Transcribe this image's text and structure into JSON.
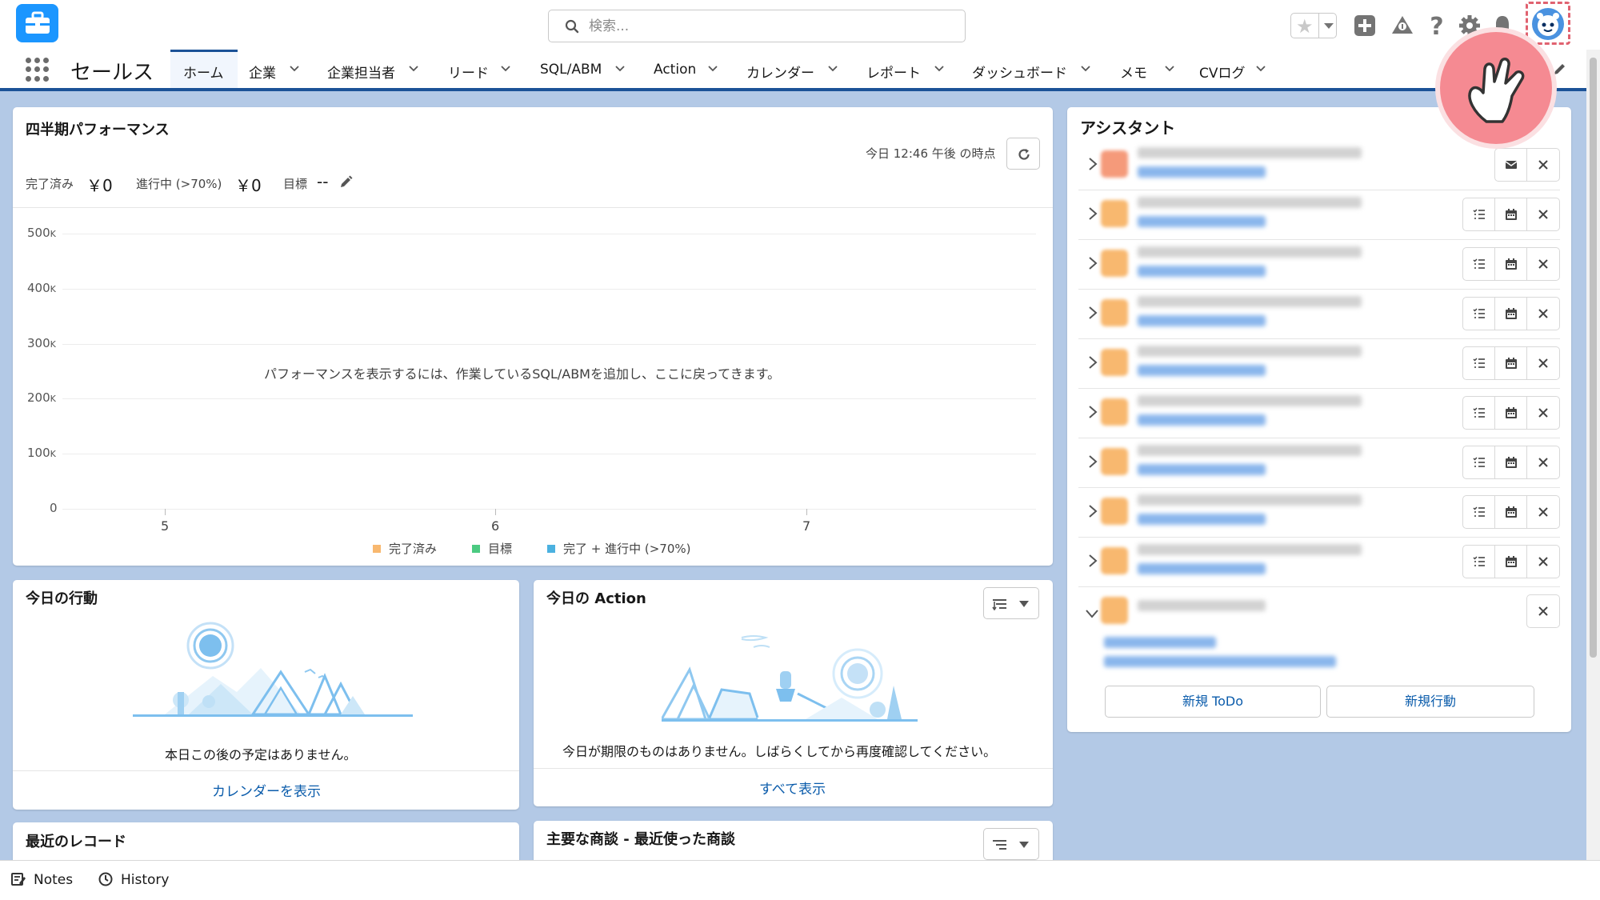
{
  "header": {
    "search_placeholder": "検索...",
    "app_name": "セールス"
  },
  "nav": {
    "items": [
      {
        "label": "ホーム",
        "active": true
      },
      {
        "label": "企業"
      },
      {
        "label": "企業担当者"
      },
      {
        "label": "リード"
      },
      {
        "label": "SQL/ABM"
      },
      {
        "label": "Action"
      },
      {
        "label": "カレンダー"
      },
      {
        "label": "レポート"
      },
      {
        "label": "ダッシュボード"
      },
      {
        "label": "メモ"
      },
      {
        "label": "CVログ"
      }
    ]
  },
  "performance": {
    "title": "四半期パフォーマンス",
    "timestamp": "今日 12:46 午後 の時点",
    "closed_label": "完了済み",
    "closed_value": "￥0",
    "open_label": "進行中 (>70%)",
    "open_value": "￥0",
    "goal_label": "目標",
    "goal_value": "--",
    "empty_message": "パフォーマンスを表示するには、作業しているSQL/ABMを追加し、ここに戻ってきます。"
  },
  "chart_data": {
    "type": "line",
    "x": [
      "5",
      "6",
      "7"
    ],
    "series": [
      {
        "name": "完了済み",
        "values": []
      },
      {
        "name": "目標",
        "values": []
      },
      {
        "name": "完了 + 進行中 (>70%)",
        "values": []
      }
    ],
    "y_ticks": [
      {
        "num": "500",
        "unit": "K"
      },
      {
        "num": "400",
        "unit": "K"
      },
      {
        "num": "300",
        "unit": "K"
      },
      {
        "num": "200",
        "unit": "K"
      },
      {
        "num": "100",
        "unit": "K"
      },
      {
        "num": "0",
        "unit": ""
      }
    ],
    "ylim": [
      0,
      500000
    ],
    "legend": [
      {
        "label": "完了済み",
        "color": "#f8b86f"
      },
      {
        "label": "目標",
        "color": "#4bca81"
      },
      {
        "label": "完了 + 進行中 (>70%)",
        "color": "#4bb1e0"
      }
    ],
    "colors": {
      "closed": "#f8b86f",
      "goal": "#4bca81",
      "open": "#4bb1e0"
    }
  },
  "assistant": {
    "title": "アシスタント",
    "new_todo": "新規 ToDo",
    "new_event": "新規行動"
  },
  "today_events": {
    "title": "今日の行動",
    "empty": "本日この後の予定はありません。",
    "link": "カレンダーを表示"
  },
  "today_action": {
    "title": "今日の Action",
    "empty": "今日が期限のものはありません。しばらくしてから再度確認してください。",
    "link": "すべて表示"
  },
  "recent_records": {
    "title": "最近のレコード"
  },
  "key_deals": {
    "title": "主要な商談 - 最近使った商談"
  },
  "utility": {
    "notes": "Notes",
    "history": "History"
  }
}
